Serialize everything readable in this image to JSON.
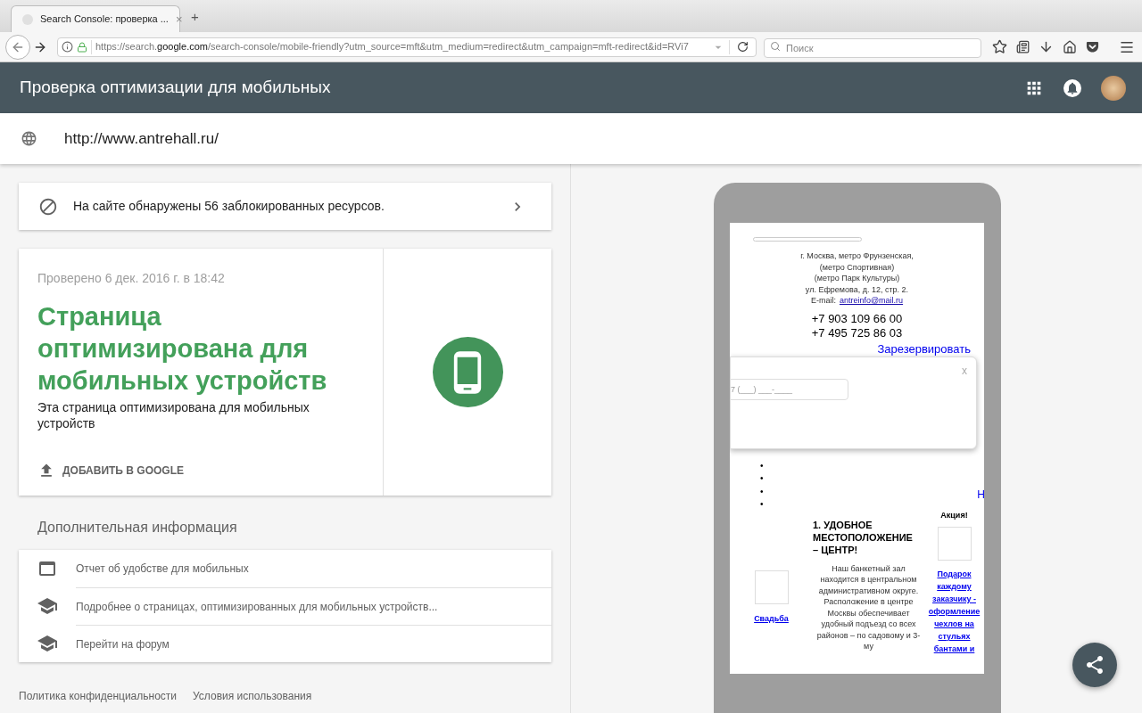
{
  "browser": {
    "tab": {
      "title": "Search Console: проверка ...",
      "close": "×",
      "selected": true
    },
    "new_tab": "+",
    "url": {
      "prefix": "https://search.",
      "domain": "google.com",
      "rest": "/search-console/mobile-friendly?utm_source=mft&utm_medium=redirect&utm_campaign=mft-redirect&id=RVi7"
    },
    "search": {
      "placeholder": "Поиск"
    }
  },
  "app_bar": {
    "title": "Проверка оптимизации для мобильных"
  },
  "url_field": {
    "value": "http://www.antrehall.ru/"
  },
  "blocked_banner": {
    "text": "На сайте обнаружены 56 заблокированных ресурсов."
  },
  "result": {
    "checked": "Проверено 6 дек. 2016 г. в 18:42",
    "title": "Страница оптимизирована для мобильных устройств",
    "description": "Эта страница оптимизирована для мобильных устройств",
    "action": "ДОБАВИТЬ В GOOGLE",
    "mobile_friendly": true
  },
  "more_info": {
    "heading": "Дополнительная информация",
    "items": [
      {
        "kind": "report",
        "text": "Отчет об удобстве для мобильных"
      },
      {
        "kind": "learn",
        "text": "Подробнее о страницах, оптимизированных для мобильных устройств..."
      },
      {
        "kind": "learn",
        "text": "Перейти на форум"
      }
    ]
  },
  "footer": [
    "Политика конфиденциальности",
    "Условия использования"
  ],
  "preview": {
    "address_lines": [
      "г. Москва, метро Фрунзенская,",
      "(метро Спортивная)",
      "(метро Парк Культуры)",
      "ул. Ефремова, д. 12, стр. 2."
    ],
    "email_label": "E-mail:",
    "email": "antreinfo@mail.ru",
    "phones": [
      "+7 903 109 66 00",
      "+7 495 725 86 03"
    ],
    "reserve": "Зарезервировать",
    "popup": {
      "close": "x",
      "phone_placeholder": "7 (___) ___-____"
    },
    "bullets": [
      "•",
      "•",
      "•",
      "•"
    ],
    "edge_link": "Н",
    "wedding": "Свадьба",
    "heading": "1. УДОБНОЕ МЕСТОПОЛОЖЕНИЕ – ЦЕНТР!",
    "body": "Наш банкетный зал находится в центральном административном округе. Расположение в центре Москвы обеспечивает удобный подъезд со всех районов – по садовому и 3-му",
    "promo_title": "Акция!",
    "promo_link": "Подарок каждому заказчику - оформление чехлов на стульях бантами и"
  }
}
